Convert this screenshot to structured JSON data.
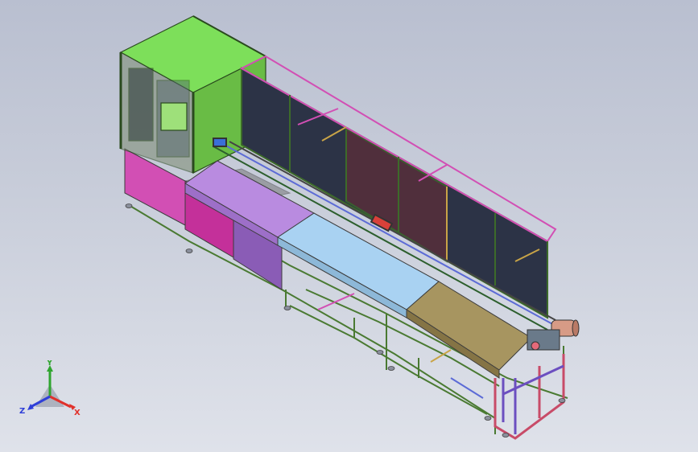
{
  "viewport": {
    "background_top": "#b9bfd0",
    "background_bottom": "#dfe2ea"
  },
  "model": {
    "colors": {
      "cabinet_green": "#7ddf5a",
      "frame_green": "#4a7a32",
      "mesh_dark": "#2c3346",
      "panel_magenta": "#d24fb4",
      "panel_purple": "#8a5cb6",
      "conveyor_lilac": "#b98be0",
      "conveyor_blue": "#a9d2f2",
      "conveyor_khaki": "#a79560",
      "red_accent": "#d8413a",
      "copper": "#d79b86"
    }
  },
  "triad": {
    "labels": {
      "x": "X",
      "y": "Y",
      "z": "Z"
    },
    "colors": {
      "x": "#e0312b",
      "y": "#2fa52f",
      "z": "#2f3fd8"
    }
  }
}
